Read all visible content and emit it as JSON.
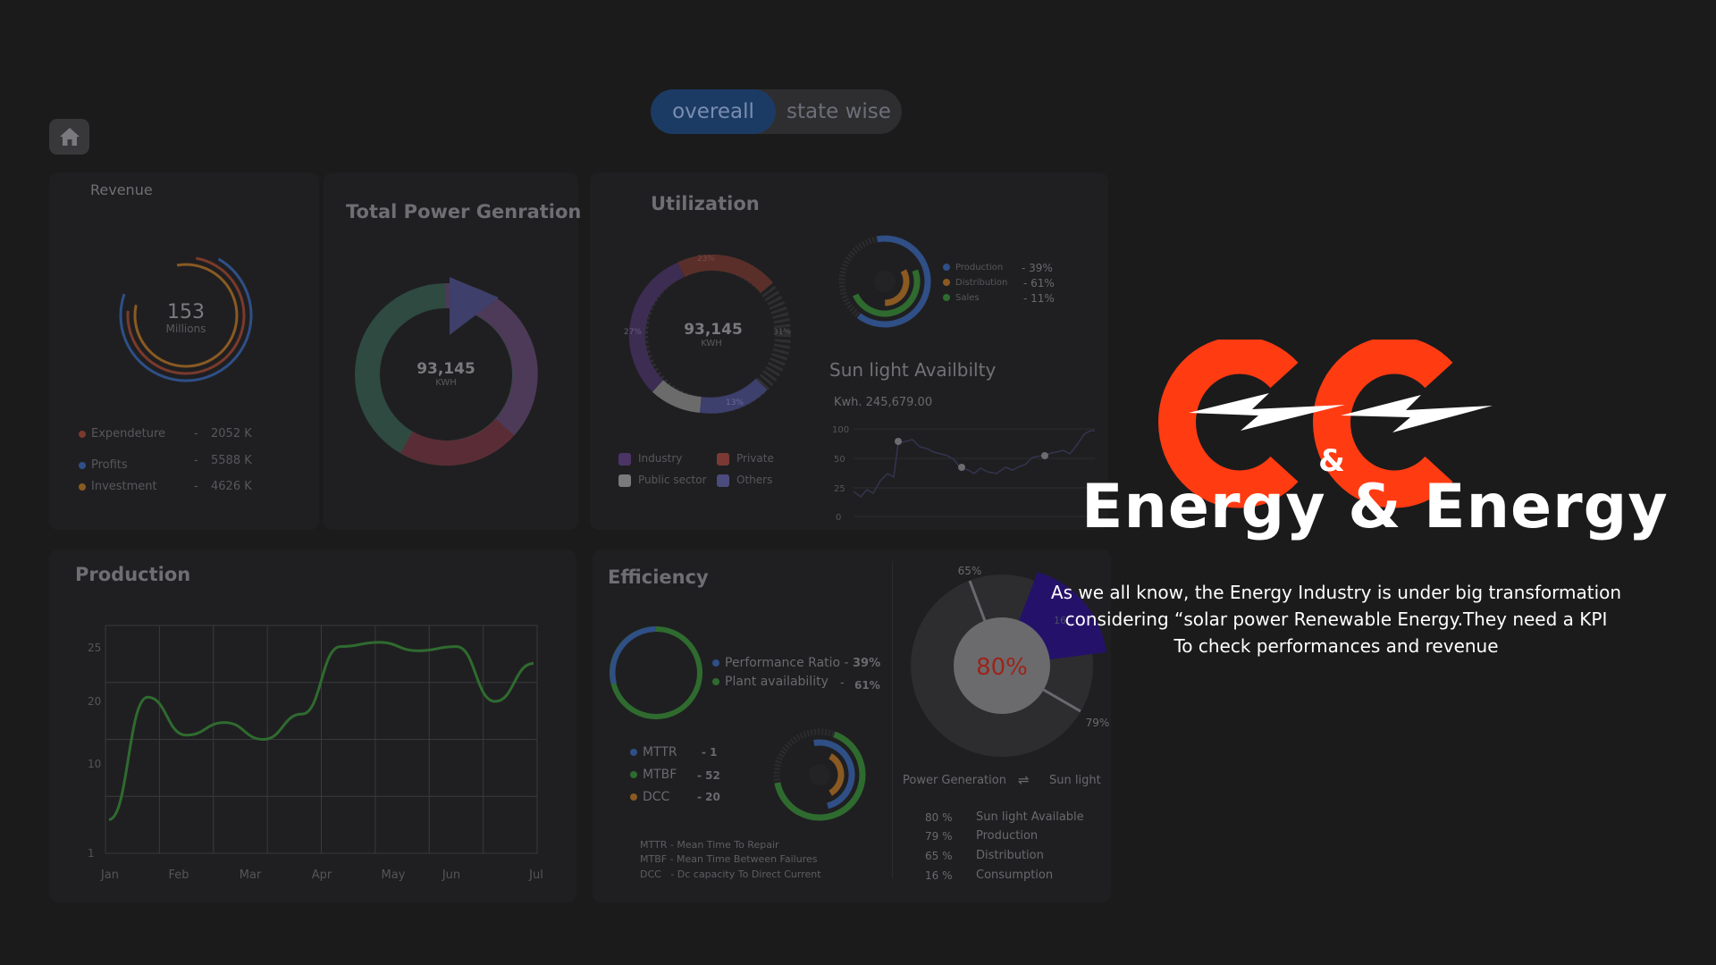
{
  "toggle": {
    "active": "overeall",
    "inactive": "state wise"
  },
  "colors": {
    "accent_red": "#ff3b12",
    "toggle_active": "#1b3b64",
    "background": "#1b1b1c"
  },
  "revenue": {
    "title": "Revenue",
    "center_value": "153",
    "center_unit": "Millions",
    "legend": [
      {
        "label": "Expendeture",
        "dash": "-",
        "value": "2052 K",
        "color": "#7a3a2c"
      },
      {
        "label": "Profits",
        "dash": "-",
        "value": "5588 K",
        "color": "#2f4f86"
      },
      {
        "label": "Investment",
        "dash": "-",
        "value": "4626 K",
        "color": "#8a5a22"
      }
    ]
  },
  "total_power": {
    "title": "Total Power Genration",
    "center_value": "93,145",
    "center_unit": "KWH"
  },
  "utilization": {
    "title": "Utilization",
    "center_value": "93,145",
    "center_unit": "KWH",
    "segment_labels": [
      "23%",
      "27%",
      "31%",
      "13%"
    ],
    "legend": [
      {
        "label": "Industry",
        "color": "#4a3566"
      },
      {
        "label": "Private",
        "color": "#7a3a33"
      },
      {
        "label": "Public sector",
        "color": "#7a7a7a"
      },
      {
        "label": "Others",
        "color": "#4b4b7e"
      }
    ],
    "ring_legend": [
      {
        "label": "Production",
        "value": "- 39%",
        "color": "#2f4f86"
      },
      {
        "label": "Distribution",
        "value": "- 61%",
        "color": "#8a5a22"
      },
      {
        "label": "Sales",
        "value": "- 11%",
        "color": "#2f6b2f"
      }
    ]
  },
  "sunlight": {
    "title": "Sun light Availbilty",
    "kwh_label": "Kwh. 245,679.00",
    "y_ticks": [
      "100",
      "50",
      "25",
      "0"
    ]
  },
  "production": {
    "title": "Production",
    "chart_data": {
      "type": "line",
      "categories": [
        "Jan",
        "Feb",
        "Mar",
        "Apr",
        "May",
        "Jun",
        "Jul"
      ],
      "y_ticks": [
        "25",
        "20",
        "10",
        "1"
      ],
      "values": [
        4,
        18.5,
        14,
        15.5,
        13.5,
        16.5,
        24.5,
        25,
        24,
        24.5,
        18,
        22.5
      ],
      "line_color": "#2f6b2f"
    }
  },
  "efficiency": {
    "title": "Efficiency",
    "ratio_legend": [
      {
        "label": "Performance Ratio -",
        "value": "39%",
        "color": "#2f4f86"
      },
      {
        "label": "Plant availability",
        "dash": "-",
        "value": "61%",
        "color": "#2f6b2f"
      }
    ],
    "metrics": [
      {
        "label": "MTTR",
        "value": "- 1",
        "color": "#2f4f86"
      },
      {
        "label": "MTBF",
        "value": "- 52",
        "color": "#2f6b2f"
      },
      {
        "label": "DCC",
        "value": "- 20",
        "color": "#8a5a22"
      }
    ],
    "definitions": [
      "MTTR - Mean Time To Repair",
      "MTBF - Mean Time Between Failures",
      "DCC   - Dc capacity To Direct Current"
    ]
  },
  "power_sun": {
    "pie_center": "80%",
    "label_65": "65%",
    "label_79": "79%",
    "label_16": "16",
    "legend_left": "Power Generation",
    "legend_swap": "⇌",
    "legend_right": "Sun light",
    "rows": [
      {
        "pct": "80 %",
        "label": "Sun light Available"
      },
      {
        "pct": "79 %",
        "label": "Production"
      },
      {
        "pct": "65 %",
        "label": "Distribution"
      },
      {
        "pct": "16 %",
        "label": "Consumption"
      }
    ]
  },
  "brand": {
    "logo_ampersand": "&",
    "name": "Energy & Energy",
    "tagline": [
      "As we all know, the Energy Industry is under big transformation",
      "considering “solar power Renewable Energy.They need a KPI",
      "To check performances and revenue"
    ]
  }
}
